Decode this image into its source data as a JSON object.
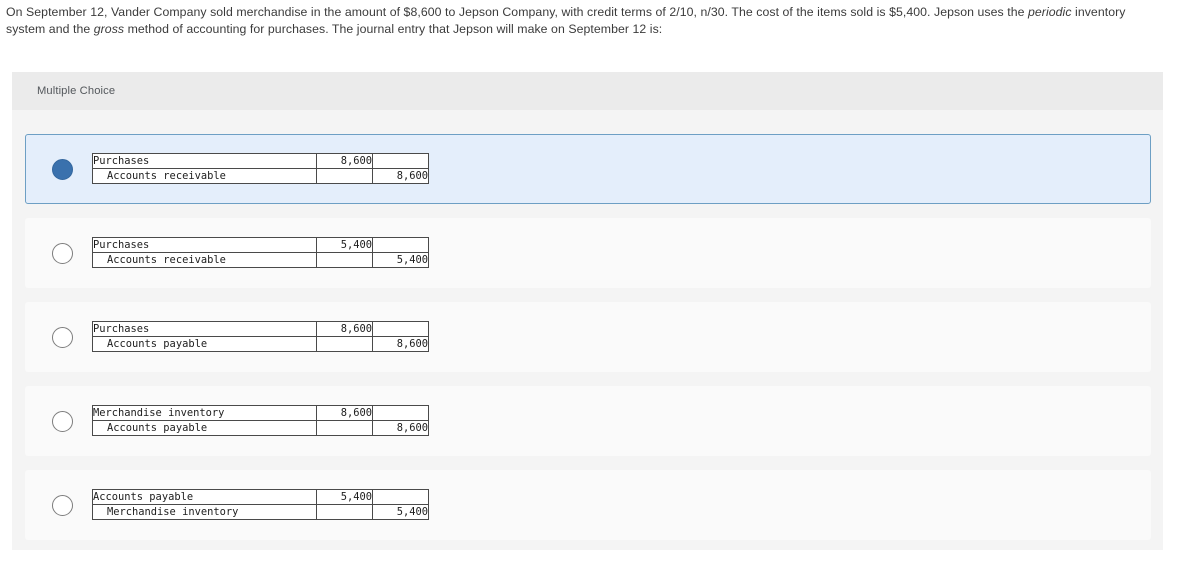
{
  "question": {
    "text_parts": [
      {
        "text": "On September 12, Vander Company sold merchandise in the amount of $8,600 to Jepson Company, with credit terms of 2/10, n/30. The cost of the items sold is $5,400. Jepson uses the ",
        "italic": false
      },
      {
        "text": "periodic",
        "italic": true
      },
      {
        "text": " inventory system and the ",
        "italic": false
      },
      {
        "text": "gross",
        "italic": true
      },
      {
        "text": " method of accounting for purchases. The journal entry that Jepson will make on September 12 is:",
        "italic": false
      }
    ],
    "plain_text": "On September 12, Vander Company sold merchandise in the amount of $8,600 to Jepson Company, with credit terms of 2/10, n/30. The cost of the items sold is $5,400. Jepson uses the periodic inventory system and the gross method of accounting for purchases. The journal entry that Jepson will make on September 12 is:"
  },
  "panel": {
    "header_label": "Multiple Choice"
  },
  "colors": {
    "selected_fill": "#e4eefb",
    "selected_border": "#6d9fc4",
    "radio_selected": "#3a71ad",
    "option_fill": "#fafafa",
    "panel_bg": "#f4f4f4",
    "panel_header_bg": "#ebebeb",
    "text": "#3b3b3b"
  },
  "options": [
    {
      "id": "option-1",
      "selected": true,
      "rows": [
        {
          "account": "Purchases",
          "indent": false,
          "debit": "8,600",
          "credit": ""
        },
        {
          "account": "Accounts receivable",
          "indent": true,
          "debit": "",
          "credit": "8,600"
        }
      ]
    },
    {
      "id": "option-2",
      "selected": false,
      "rows": [
        {
          "account": "Purchases",
          "indent": false,
          "debit": "5,400",
          "credit": ""
        },
        {
          "account": "Accounts receivable",
          "indent": true,
          "debit": "",
          "credit": "5,400"
        }
      ]
    },
    {
      "id": "option-3",
      "selected": false,
      "rows": [
        {
          "account": "Purchases",
          "indent": false,
          "debit": "8,600",
          "credit": ""
        },
        {
          "account": "Accounts payable",
          "indent": true,
          "debit": "",
          "credit": "8,600"
        }
      ]
    },
    {
      "id": "option-4",
      "selected": false,
      "rows": [
        {
          "account": "Merchandise inventory",
          "indent": false,
          "debit": "8,600",
          "credit": ""
        },
        {
          "account": "Accounts payable",
          "indent": true,
          "debit": "",
          "credit": "8,600"
        }
      ]
    },
    {
      "id": "option-5",
      "selected": false,
      "rows": [
        {
          "account": "Accounts payable",
          "indent": false,
          "debit": "5,400",
          "credit": ""
        },
        {
          "account": "Merchandise inventory",
          "indent": true,
          "debit": "",
          "credit": "5,400"
        }
      ]
    }
  ]
}
